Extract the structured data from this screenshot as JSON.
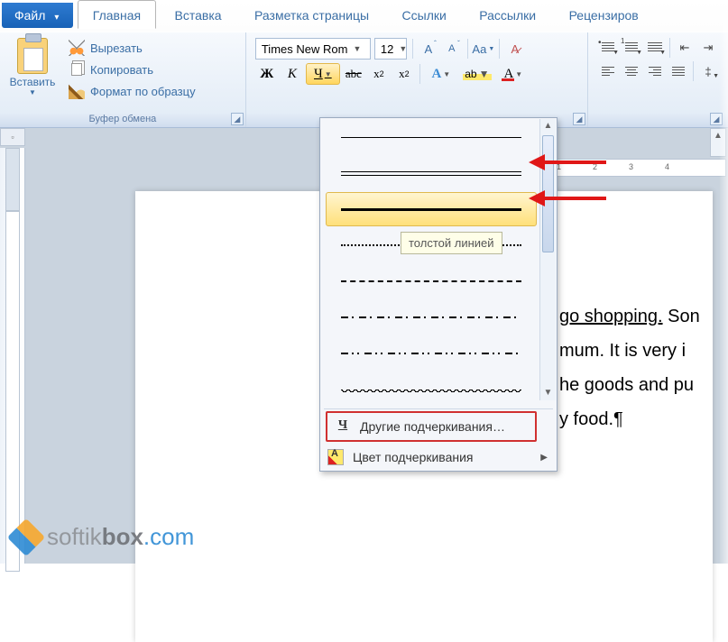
{
  "tabs": {
    "file": "Файл",
    "home": "Главная",
    "insert": "Вставка",
    "layout": "Разметка страницы",
    "refs": "Ссылки",
    "mail": "Рассылки",
    "review": "Рецензиров"
  },
  "clipboard": {
    "paste": "Вставить",
    "cut": "Вырезать",
    "copy": "Копировать",
    "format_painter": "Формат по образцу",
    "group": "Буфер обмена"
  },
  "font": {
    "name": "Times New Rom",
    "size": "12"
  },
  "underline_menu": {
    "tooltip": "толстой линией",
    "more": "Другие подчеркивания…",
    "color": "Цвет подчеркивания"
  },
  "ruler": {
    "n1": "1",
    "n2": "2",
    "n3": "3",
    "n4": "4"
  },
  "doc": {
    "l1a": "go shopping.",
    "l1b": " Son",
    "l2": "mum. It is very i",
    "l3": "he goods and pu",
    "l4": "y food.¶"
  },
  "watermark": {
    "a": "softik",
    "b": "box",
    "c": ".com"
  }
}
